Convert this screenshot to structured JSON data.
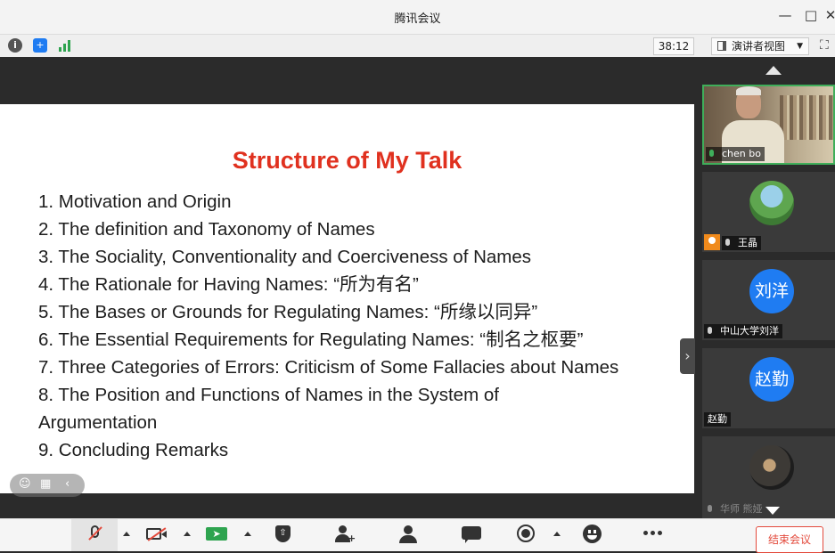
{
  "window": {
    "title": "腾讯会议"
  },
  "toolbar": {
    "timer": "38:12",
    "view_mode": "演讲者视图"
  },
  "slide": {
    "title": "Structure of My Talk",
    "items": [
      "1. Motivation and Origin",
      "2. The definition and Taxonomy of Names",
      "3. The Sociality, Conventionality and Coerciveness of Names",
      "4. The Rationale for Having Names: “所为有名”",
      "5. The Bases or Grounds for Regulating Names: “所缘以同异”",
      "6. The Essential Requirements for Regulating Names: “制名之枢要”",
      "7. Three Categories of Errors: Criticism of Some Fallacies about Names",
      "8. The Position and Functions of Names in the System of Argumentation",
      "9. Concluding Remarks"
    ]
  },
  "participants": [
    {
      "name": "chen bo",
      "avatar_text": ""
    },
    {
      "name": "王晶",
      "avatar_text": ""
    },
    {
      "name": "中山大学刘洋",
      "avatar_text": "刘洋"
    },
    {
      "name": "赵勤",
      "avatar_text": "赵勤"
    },
    {
      "name": "华师 熊娅",
      "avatar_text": ""
    }
  ],
  "bottom": {
    "end_meeting": "结束会议"
  },
  "icons": {
    "info": "info-icon",
    "shield": "shield-icon",
    "signal": "signal-icon",
    "mic": "microphone-muted-icon",
    "camera": "camera-off-icon",
    "share": "share-screen-icon",
    "security": "security-icon",
    "invite": "invite-user-icon",
    "members": "members-icon",
    "chat": "chat-icon",
    "record": "record-icon",
    "emoji": "emoji-icon",
    "more": "more-icon"
  },
  "colors": {
    "title_red": "#e0311f",
    "accent_blue": "#1f7cf2",
    "active_green": "#3fae5a",
    "end_red": "#e34a3c"
  }
}
